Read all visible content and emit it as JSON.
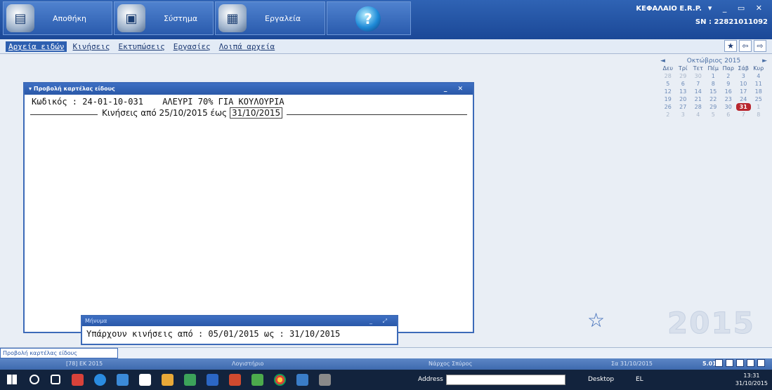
{
  "toolbar": {
    "buttons": [
      {
        "label": "Αποθήκη"
      },
      {
        "label": "Σύστημα"
      },
      {
        "label": "Εργαλεία"
      }
    ]
  },
  "window": {
    "title": "ΚΕΦΑΛΑΙΟ E.R.P.",
    "sn": "SN : 22821011092",
    "controls": "▾ _ ▭ ✕"
  },
  "menu": {
    "items": [
      "Αρχεία ειδών",
      "Κινήσεις",
      "Εκτυπώσεις",
      "Εργασίες",
      "Λοιπά αρχεία"
    ],
    "active_index": 0
  },
  "calendar": {
    "month": "Οκτώβριος 2015",
    "prev": "◄",
    "next": "►",
    "weekdays": [
      "Δευ",
      "Τρί",
      "Τετ",
      "Πέμ",
      "Παρ",
      "Σάβ",
      "Κυρ"
    ],
    "weeks": [
      [
        "28",
        "29",
        "30",
        "1",
        "2",
        "3",
        "4"
      ],
      [
        "5",
        "6",
        "7",
        "8",
        "9",
        "10",
        "11"
      ],
      [
        "12",
        "13",
        "14",
        "15",
        "16",
        "17",
        "18"
      ],
      [
        "19",
        "20",
        "21",
        "22",
        "23",
        "24",
        "25"
      ],
      [
        "26",
        "27",
        "28",
        "29",
        "30",
        "31",
        "1"
      ],
      [
        "2",
        "3",
        "4",
        "5",
        "6",
        "7",
        "8"
      ]
    ],
    "today": "31"
  },
  "card_window": {
    "title": "Προβολή καρτέλας είδους",
    "controls": "_ ✕",
    "code_label": "Κωδικός : 24-01-10-031",
    "description": "ΑΛΕΥΡΙ 70% ΓΙΑ ΚΟΥΛΟΥΡΙΑ",
    "range_prefix": "Κινήσεις από 25/10/2015 έως",
    "range_to": "31/10/2015"
  },
  "message": {
    "title": "Μήνυμα",
    "controls": "_ ⤢",
    "text": "Υπάρχουν κινήσεις από : 05/01/2015 ως : 31/10/2015"
  },
  "watermark": {
    "year": "2015",
    "star": "☆"
  },
  "status": {
    "tab": "Προβολή καρτέλας είδους"
  },
  "infobar": {
    "company": "[78] ΕΚ 2015",
    "module": "Λογιστήριο",
    "user": "Νάρχος Σπύρος",
    "date": "Σα 31/10/2015",
    "version": "5.01b"
  },
  "taskbar": {
    "address_label": "Address",
    "desktop": "Desktop",
    "lang": "EL",
    "time": "13:31",
    "date": "31/10/2015"
  }
}
